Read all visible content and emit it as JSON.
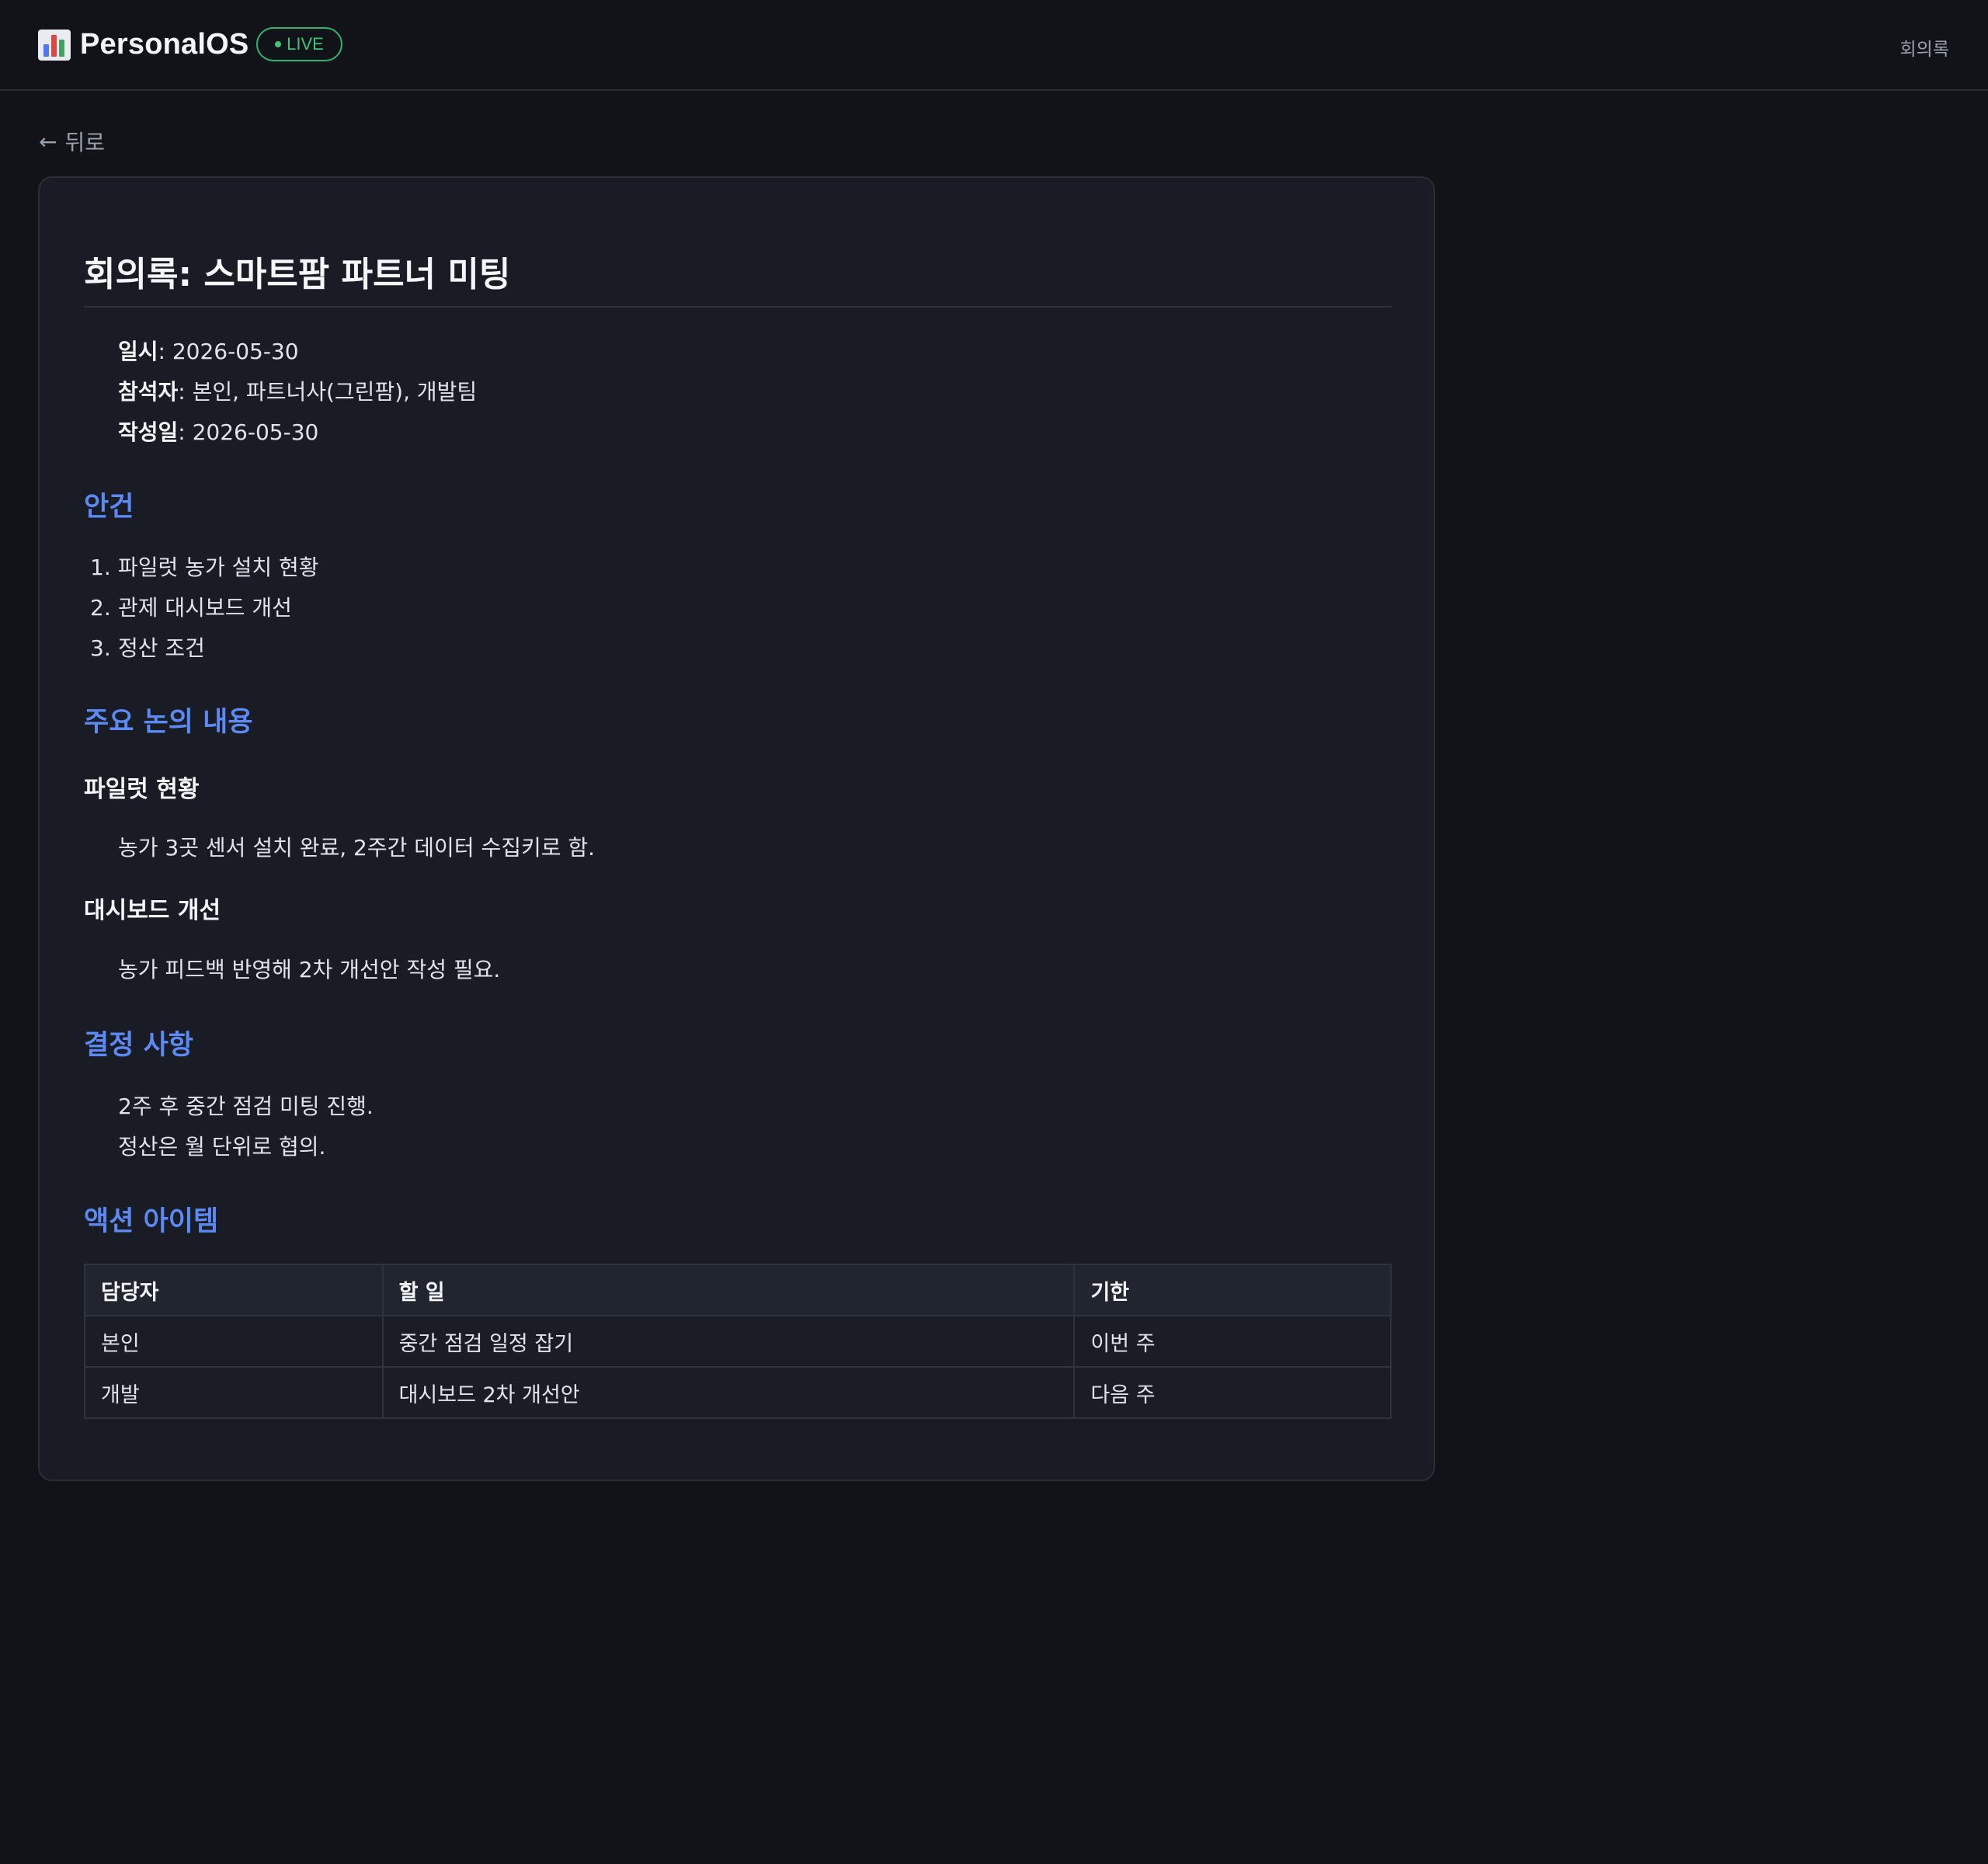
{
  "header": {
    "brand": "PersonalOS",
    "live_badge": "LIVE",
    "nav_link": "회의록"
  },
  "back_link": {
    "arrow": "←",
    "label": "뒤로"
  },
  "document": {
    "title": "회의록: 스마트팜 파트너 미팅",
    "meta": [
      {
        "label": "일시",
        "value": ": 2026-05-30"
      },
      {
        "label": "참석자",
        "value": ": 본인, 파트너사(그린팜), 개발팀"
      },
      {
        "label": "작성일",
        "value": ": 2026-05-30"
      }
    ],
    "agenda": {
      "heading": "안건",
      "items": [
        {
          "num": "1.",
          "text": "파일럿 농가 설치 현황"
        },
        {
          "num": "2.",
          "text": "관제 대시보드 개선"
        },
        {
          "num": "3.",
          "text": "정산 조건"
        }
      ]
    },
    "discussion": {
      "heading": "주요 논의 내용",
      "topics": [
        {
          "title": "파일럿 현황",
          "body": "농가 3곳 센서 설치 완료, 2주간 데이터 수집키로 함."
        },
        {
          "title": "대시보드 개선",
          "body": "농가 피드백 반영해 2차 개선안 작성 필요."
        }
      ]
    },
    "decisions": {
      "heading": "결정 사항",
      "lines": [
        "2주 후 중간 점검 미팅 진행.",
        "정산은 월 단위로 협의."
      ]
    },
    "actions": {
      "heading": "액션 아이템",
      "columns": [
        "담당자",
        "할 일",
        "기한"
      ],
      "rows": [
        [
          "본인",
          "중간 점검 일정 잡기",
          "이번 주"
        ],
        [
          "개발",
          "대시보드 2차 개선안",
          "다음 주"
        ]
      ]
    }
  },
  "colors": {
    "background": "#111318",
    "card": "#191c24",
    "accent_heading": "#5b8af5",
    "live_green": "#3cc47f"
  },
  "icons": {
    "brand_icon": "bar-chart-icon",
    "back_icon": "left-arrow-icon"
  }
}
